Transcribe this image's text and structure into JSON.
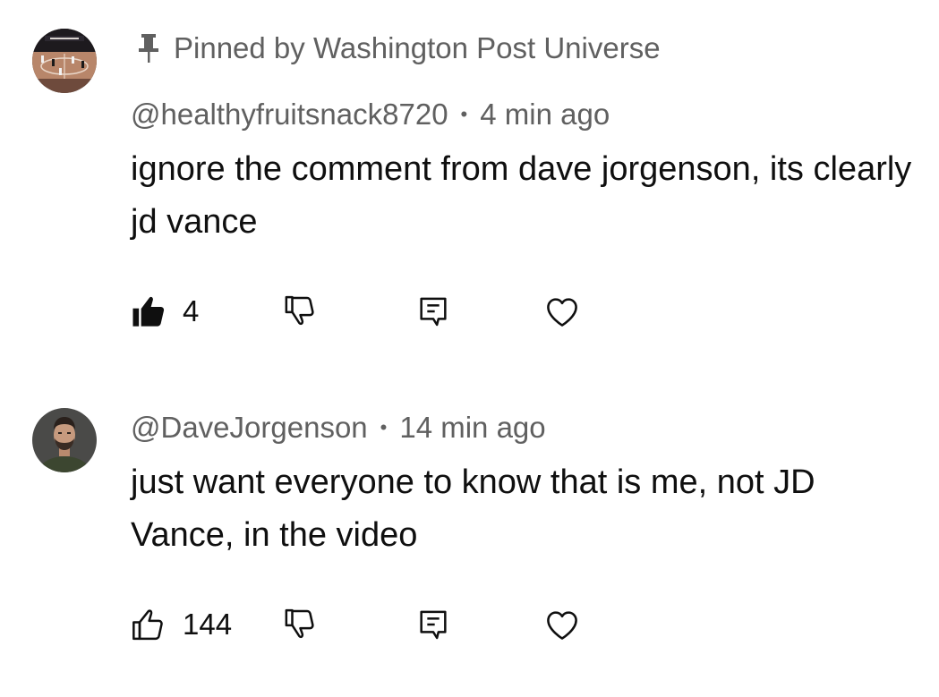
{
  "comments": [
    {
      "pinned_label": "Pinned by Washington Post Universe",
      "author": "@healthyfruitsnack8720",
      "separator": "•",
      "time": "4 min ago",
      "text": "ignore the comment from dave jorgenson, its clearly jd vance",
      "likes": "4",
      "liked": true,
      "avatar_icon": "basketball-court-photo"
    },
    {
      "author": "@DaveJorgenson",
      "separator": "•",
      "time": "14 min ago",
      "text": "just want everyone to know that is me, not JD Vance, in the video",
      "likes": "144",
      "liked": false,
      "avatar_icon": "bearded-man-photo"
    }
  ],
  "icons": {
    "pin": "pin-icon",
    "like": "thumbs-up-icon",
    "dislike": "thumbs-down-icon",
    "reply": "reply-icon",
    "heart": "heart-icon"
  },
  "colors": {
    "text": "#0f0f0f",
    "secondary_text": "#606060",
    "background": "#ffffff"
  }
}
